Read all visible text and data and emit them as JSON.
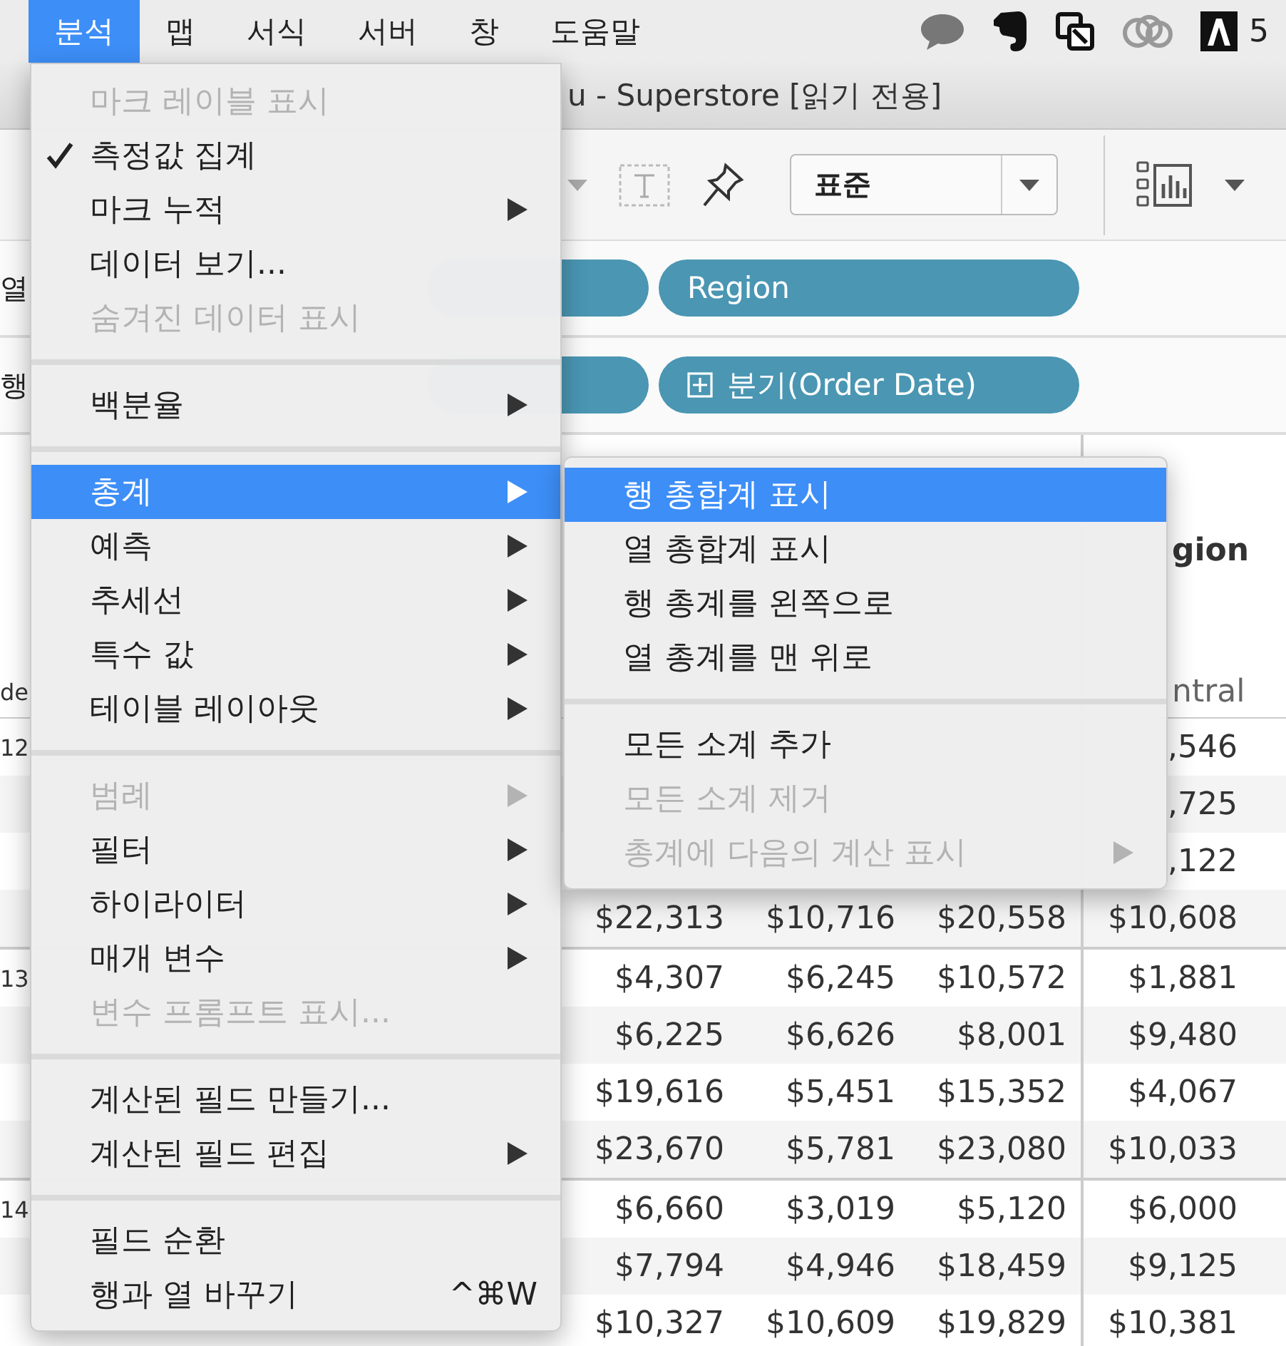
{
  "menu_bar": {
    "items": [
      {
        "label": "분석",
        "selected": true
      },
      {
        "label": "맵",
        "selected": false
      },
      {
        "label": "서식",
        "selected": false
      },
      {
        "label": "서버",
        "selected": false
      },
      {
        "label": "창",
        "selected": false
      },
      {
        "label": "도움말",
        "selected": false
      }
    ],
    "status_text": "5"
  },
  "window": {
    "title": "u - Superstore [읽기 전용]"
  },
  "toolbar": {
    "view_size": "표준"
  },
  "shelves": [
    {
      "label": "열",
      "pills": [
        {
          "kind": "cut"
        },
        {
          "kind": "field",
          "label": "Region",
          "expandable": false
        }
      ]
    },
    {
      "label": "행",
      "pills": [
        {
          "kind": "cut"
        },
        {
          "kind": "field",
          "label": "분기(Order Date)",
          "expandable": true
        }
      ]
    }
  ],
  "table": {
    "header": "gion",
    "subheader": "ntral",
    "row_header": "de",
    "groups": [
      {
        "label": "12",
        "rows": [
          {
            "cells": [
              "",
              "",
              "",
              ",546"
            ]
          },
          {
            "cells": [
              "",
              "",
              "",
              ",725"
            ]
          },
          {
            "cells": [
              "",
              "",
              "",
              ",122"
            ]
          },
          {
            "cells": [
              "$22,313",
              "$10,716",
              "$20,558",
              "$10,608"
            ]
          }
        ]
      },
      {
        "label": "13",
        "rows": [
          {
            "cells": [
              "$4,307",
              "$6,245",
              "$10,572",
              "$1,881"
            ]
          },
          {
            "cells": [
              "$6,225",
              "$6,626",
              "$8,001",
              "$9,480"
            ]
          },
          {
            "cells": [
              "$19,616",
              "$5,451",
              "$15,352",
              "$4,067"
            ]
          },
          {
            "cells": [
              "$23,670",
              "$5,781",
              "$23,080",
              "$10,033"
            ]
          }
        ]
      },
      {
        "label": "14",
        "rows": [
          {
            "cells": [
              "$6,660",
              "$3,019",
              "$5,120",
              "$6,000"
            ]
          },
          {
            "cells": [
              "$7,794",
              "$4,946",
              "$18,459",
              "$9,125"
            ]
          },
          {
            "cells": [
              "$10,327",
              "$10,609",
              "$19,829",
              "$10,381"
            ]
          }
        ]
      }
    ]
  },
  "menu": {
    "items": [
      {
        "kind": "item",
        "label": "마크 레이블 표시",
        "disabled": true,
        "checked": false,
        "selected": false,
        "submenu": false
      },
      {
        "kind": "item",
        "label": "측정값 집계",
        "disabled": false,
        "checked": true,
        "selected": false,
        "submenu": false
      },
      {
        "kind": "item",
        "label": "마크 누적",
        "disabled": false,
        "checked": false,
        "selected": false,
        "submenu": true
      },
      {
        "kind": "item",
        "label": "데이터 보기...",
        "disabled": false,
        "checked": false,
        "selected": false,
        "submenu": false
      },
      {
        "kind": "item",
        "label": "숨겨진 데이터 표시",
        "disabled": true,
        "checked": false,
        "selected": false,
        "submenu": false
      },
      {
        "kind": "separator"
      },
      {
        "kind": "item",
        "label": "백분율",
        "disabled": false,
        "checked": false,
        "selected": false,
        "submenu": true
      },
      {
        "kind": "separator"
      },
      {
        "kind": "item",
        "label": "총계",
        "disabled": false,
        "checked": false,
        "selected": true,
        "submenu": true
      },
      {
        "kind": "item",
        "label": "예측",
        "disabled": false,
        "checked": false,
        "selected": false,
        "submenu": true
      },
      {
        "kind": "item",
        "label": "추세선",
        "disabled": false,
        "checked": false,
        "selected": false,
        "submenu": true
      },
      {
        "kind": "item",
        "label": "특수 값",
        "disabled": false,
        "checked": false,
        "selected": false,
        "submenu": true
      },
      {
        "kind": "item",
        "label": "테이블 레이아웃",
        "disabled": false,
        "checked": false,
        "selected": false,
        "submenu": true
      },
      {
        "kind": "separator"
      },
      {
        "kind": "item",
        "label": "범례",
        "disabled": true,
        "checked": false,
        "selected": false,
        "submenu": true
      },
      {
        "kind": "item",
        "label": "필터",
        "disabled": false,
        "checked": false,
        "selected": false,
        "submenu": true
      },
      {
        "kind": "item",
        "label": "하이라이터",
        "disabled": false,
        "checked": false,
        "selected": false,
        "submenu": true
      },
      {
        "kind": "item",
        "label": "매개 변수",
        "disabled": false,
        "checked": false,
        "selected": false,
        "submenu": true
      },
      {
        "kind": "item",
        "label": "변수 프롬프트 표시...",
        "disabled": true,
        "checked": false,
        "selected": false,
        "submenu": false
      },
      {
        "kind": "separator"
      },
      {
        "kind": "item",
        "label": "계산된 필드 만들기...",
        "disabled": false,
        "checked": false,
        "selected": false,
        "submenu": false
      },
      {
        "kind": "item",
        "label": "계산된 필드 편집",
        "disabled": false,
        "checked": false,
        "selected": false,
        "submenu": true
      },
      {
        "kind": "separator"
      },
      {
        "kind": "item",
        "label": "필드 순환",
        "disabled": false,
        "checked": false,
        "selected": false,
        "submenu": false
      },
      {
        "kind": "item",
        "label": "행과 열 바꾸기",
        "disabled": false,
        "checked": false,
        "selected": false,
        "submenu": false,
        "shortcut": "^⌘W"
      }
    ]
  },
  "submenu": {
    "items": [
      {
        "kind": "item",
        "label": "행 총합계 표시",
        "disabled": false,
        "selected": true,
        "submenu": false
      },
      {
        "kind": "item",
        "label": "열 총합계 표시",
        "disabled": false,
        "selected": false,
        "submenu": false
      },
      {
        "kind": "item",
        "label": "행 총계를 왼쪽으로",
        "disabled": false,
        "selected": false,
        "submenu": false
      },
      {
        "kind": "item",
        "label": "열 총계를 맨 위로",
        "disabled": false,
        "selected": false,
        "submenu": false
      },
      {
        "kind": "separator"
      },
      {
        "kind": "item",
        "label": "모든 소계 추가",
        "disabled": false,
        "selected": false,
        "submenu": false
      },
      {
        "kind": "item",
        "label": "모든 소계 제거",
        "disabled": true,
        "selected": false,
        "submenu": false
      },
      {
        "kind": "item",
        "label": "총계에 다음의 계산 표시",
        "disabled": true,
        "selected": false,
        "submenu": true
      }
    ]
  }
}
